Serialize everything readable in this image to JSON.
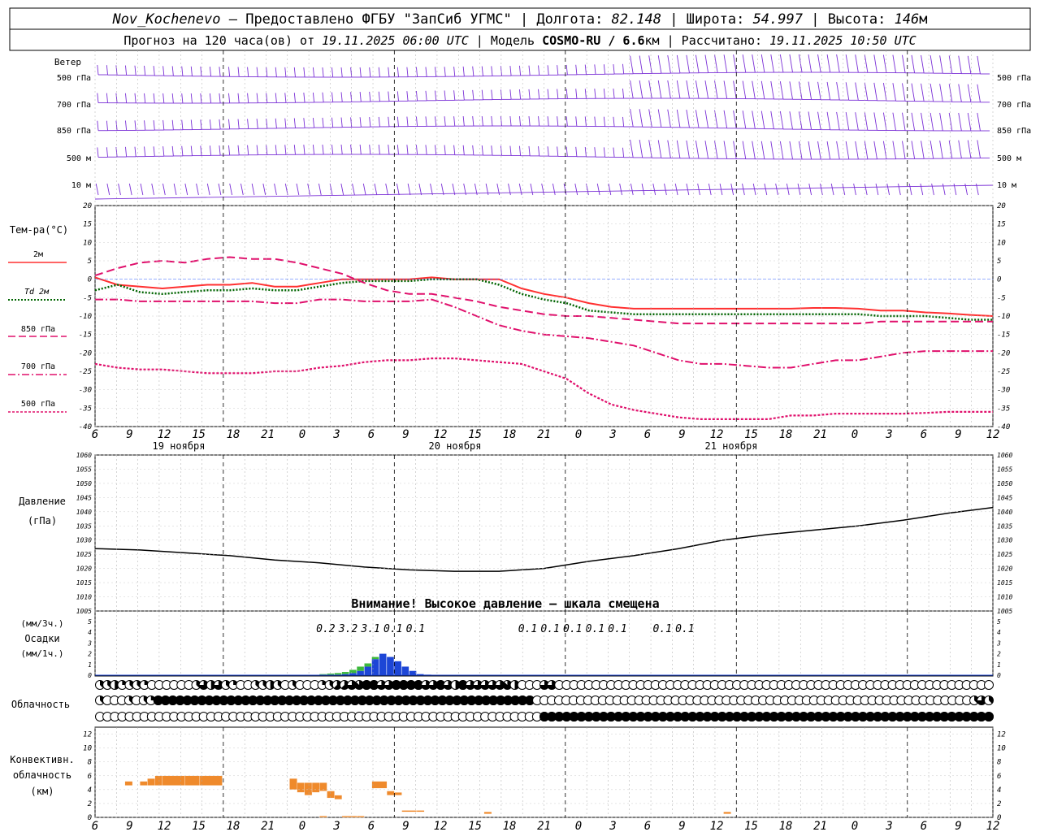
{
  "header": {
    "station": "Nov_Kochenevo",
    "provider": " – Предоставлено ФГБУ \"ЗапСиб УГМС\" | Долгота: ",
    "lon": "82.148",
    "lat_label": " | Широта: ",
    "lat": "54.997",
    "alt_label": " | Высота: ",
    "alt": "146",
    "alt_unit": "м",
    "line2_a": "Прогноз на 120 часа(ов) от ",
    "run_time": "19.11.2025 06:00 UTC",
    "line2_b": " | Модель ",
    "model": "COSMO-RU / 6.6",
    "model_unit": "км",
    "line2_c": " | Рассчитано: ",
    "calc_time": "19.11.2025 10:50 UTC"
  },
  "time_axis": {
    "hour_ticks": [
      "6",
      "9",
      "12",
      "15",
      "18",
      "21",
      "0",
      "3",
      "6",
      "9",
      "12",
      "15",
      "18",
      "21",
      "0",
      "3",
      "6",
      "9",
      "12",
      "15",
      "18",
      "21",
      "0",
      "3",
      "6",
      "9",
      "12"
    ],
    "day_labels": [
      "19 ноября",
      "20 ноября",
      "21 ноября"
    ]
  },
  "wind_panel": {
    "title": "Ветер",
    "levels": [
      "500 гПа",
      "700 гПа",
      "850 гПа",
      "500 м",
      "10  м"
    ]
  },
  "temp_panel": {
    "title": "Тем-ра(°C)",
    "legend": [
      {
        "label": "2м",
        "color": "#ff3030",
        "style": "solid"
      },
      {
        "label": "Td  2м",
        "color": "#006400",
        "style": "dotted"
      },
      {
        "label": "850 гПа",
        "color": "#e0106c",
        "style": "dashed"
      },
      {
        "label": "700 гПа",
        "color": "#e0106c",
        "style": "dashdot"
      },
      {
        "label": "500 гПа",
        "color": "#e0106c",
        "style": "dots"
      }
    ],
    "y_ticks": [
      "20",
      "15",
      "10",
      "5",
      "0",
      "-5",
      "-10",
      "-15",
      "-20",
      "-25",
      "-30",
      "-35",
      "-40"
    ]
  },
  "pressure_panel": {
    "title": "Давление",
    "unit": "(гПа)",
    "note": "Внимание! Высокое давление – шкала смещена",
    "y_ticks": [
      "1060",
      "1055",
      "1050",
      "1045",
      "1040",
      "1035",
      "1030",
      "1025",
      "1020",
      "1015",
      "1010",
      "1005"
    ]
  },
  "precip_panel": {
    "unit_top": "(мм/3ч.)",
    "title": "Осадки",
    "unit_bottom": "(мм/1ч.)",
    "y_ticks": [
      "5",
      "4",
      "3",
      "2",
      "1",
      "0"
    ],
    "totals": [
      "0.2",
      "3.2",
      "3.1",
      "0.1",
      "0.1",
      "0.1",
      "0.1",
      "0.1",
      "0.1",
      "0.1",
      "0.1",
      "0.1"
    ]
  },
  "cloud_panel": {
    "title": "Облачность"
  },
  "conv_panel": {
    "title_1": "Конвективн.",
    "title_2": "облачность",
    "unit": "(км)",
    "y_ticks": [
      "12",
      "10",
      "8",
      "6",
      "4",
      "2",
      "0"
    ]
  },
  "chart_data": [
    {
      "type": "line",
      "title": "Тем-ра(°C)",
      "x": [
        0,
        3,
        6,
        9,
        12,
        15,
        18,
        21,
        24,
        27,
        30,
        33,
        36,
        39,
        42,
        45,
        48,
        51,
        54,
        57,
        60,
        63,
        66,
        69,
        72,
        75,
        78,
        81,
        84,
        87,
        90,
        93,
        96,
        99,
        102,
        105,
        108,
        111,
        114,
        117,
        120
      ],
      "ylim": [
        -40,
        20
      ],
      "series": [
        {
          "name": "2м",
          "color": "#ff3030",
          "values": [
            0.5,
            -1.5,
            -2,
            -2.5,
            -2,
            -1.5,
            -1.5,
            -1,
            -2,
            -2,
            -1,
            0,
            0,
            0,
            0,
            0.5,
            0,
            0,
            0,
            -2.5,
            -4,
            -5,
            -6.5,
            -7.5,
            -8,
            -8,
            -8,
            -8,
            -8,
            -8,
            -8,
            -8,
            -7.8,
            -7.8,
            -8,
            -8.5,
            -8.5,
            -9,
            -9.3,
            -9.7,
            -10
          ]
        },
        {
          "name": "Td  2м",
          "color": "#006400",
          "values": [
            -3,
            -1.5,
            -3.5,
            -4,
            -3.5,
            -3,
            -3,
            -2.5,
            -3,
            -3,
            -2,
            -1,
            -0.5,
            -0.5,
            -0.5,
            0,
            0,
            0,
            -1.5,
            -4,
            -5.5,
            -6.5,
            -8.5,
            -9,
            -9.5,
            -9.5,
            -9.5,
            -9.5,
            -9.5,
            -9.5,
            -9.5,
            -9.5,
            -9.5,
            -9.5,
            -9.5,
            -10,
            -10,
            -10,
            -10.5,
            -11,
            -11
          ]
        },
        {
          "name": "850 гПа",
          "color": "#e0106c",
          "values": [
            1,
            3,
            4.5,
            5,
            4.5,
            5.5,
            6,
            5.5,
            5.5,
            4.5,
            3,
            1.5,
            -1,
            -3,
            -4,
            -4,
            -5,
            -6,
            -7.5,
            -8.5,
            -9.5,
            -10,
            -10,
            -10.5,
            -11,
            -11.5,
            -12,
            -12,
            -12,
            -12,
            -12,
            -12,
            -12,
            -12,
            -12,
            -11.5,
            -11.5,
            -11.5,
            -11.5,
            -11.5,
            -11.5
          ]
        },
        {
          "name": "700 гПа",
          "color": "#e0106c",
          "values": [
            -5.5,
            -5.5,
            -6,
            -6,
            -6,
            -6,
            -6,
            -6,
            -6.5,
            -6.5,
            -5.5,
            -5.5,
            -6,
            -6,
            -6,
            -5.5,
            -7.5,
            -10,
            -12.5,
            -14,
            -15,
            -15.5,
            -16,
            -17,
            -18,
            -20,
            -22,
            -23,
            -23,
            -23.5,
            -24,
            -24,
            -23,
            -22,
            -22,
            -21,
            -20,
            -19.5,
            -19.5,
            -19.5,
            -19.5
          ]
        },
        {
          "name": "500 гПа",
          "color": "#e0106c",
          "values": [
            -23,
            -24,
            -24.5,
            -24.5,
            -25,
            -25.5,
            -25.5,
            -25.5,
            -25,
            -25,
            -24,
            -23.5,
            -22.5,
            -22,
            -22,
            -21.5,
            -21.5,
            -22,
            -22.5,
            -23,
            -25,
            -27,
            -31,
            -34,
            -35.5,
            -36.5,
            -37.5,
            -38,
            -38,
            -38,
            -38,
            -37,
            -37,
            -36.5,
            -36.5,
            -36.5,
            -36.5,
            -36.3,
            -36,
            -36,
            -36
          ]
        }
      ]
    },
    {
      "type": "line",
      "title": "Давление",
      "x": [
        0,
        6,
        12,
        18,
        24,
        30,
        36,
        42,
        48,
        54,
        60,
        66,
        72,
        78,
        84,
        90,
        96,
        102,
        108,
        114,
        120
      ],
      "ylim": [
        1005,
        1060
      ],
      "series": [
        {
          "name": "Давление",
          "color": "#000000",
          "values": [
            1027,
            1026.5,
            1025.5,
            1024.5,
            1023,
            1022,
            1020.5,
            1019.5,
            1019,
            1019,
            1020,
            1022.5,
            1024.5,
            1027,
            1030,
            1032,
            1033.5,
            1035,
            1037,
            1039.5,
            1041.5
          ]
        }
      ]
    },
    {
      "type": "bar",
      "title": "Осадки",
      "x": [
        30,
        31,
        32,
        33,
        34,
        35,
        36,
        37,
        38,
        39,
        40,
        41,
        42,
        43,
        44
      ],
      "ylim": [
        0,
        5
      ],
      "series": [
        {
          "name": "liquid",
          "color": "#1d46d6",
          "values": [
            0.05,
            0.05,
            0.05,
            0.1,
            0.2,
            0.4,
            0.8,
            1.5,
            2.0,
            1.7,
            1.3,
            0.8,
            0.4,
            0.1,
            0.05
          ]
        },
        {
          "name": "mixed",
          "color": "#3cb83c",
          "values": [
            0.05,
            0.1,
            0.15,
            0.2,
            0.3,
            0.4,
            0.3,
            0.2,
            0,
            0,
            0,
            0,
            0,
            0,
            0
          ]
        }
      ],
      "totals_x": [
        33,
        36,
        39,
        42,
        45,
        60,
        63,
        66,
        69,
        72,
        78,
        81
      ]
    },
    {
      "type": "heatmap",
      "title": "Облачность",
      "rows": 3,
      "x_start": 0,
      "x_step": 1,
      "cover_in_eighths": [
        "3,3,4,2,3,3,2,0,0,0,0,0,0,3,6,4,6,3,2,0,0,3,3,4,3,0,3,0,0,0,2,3,5,5,6,7,8,8,6,6,8,8,8,8,6,6,8,6,4,8,6,6,6,6,6,7,4,0,0,0,6,6,0,0,0,0,0,0,0,0,0,0,0,0,0,0,0,0,0,0,0,0,0,0,0,0,0,0,0,0,0,0,0,0,0,0,0,0,0,0,0,0,0,0,0,0,0,0,0,0,0,0,0,0,0,0,0,0,0,0,0",
        "3,0,0,0,3,0,3,2,8,8,8,8,8,8,8,8,8,8,8,8,8,8,8,8,8,8,8,8,8,8,8,8,8,8,8,8,8,8,8,8,8,8,8,8,8,8,8,8,8,8,8,8,8,8,8,8,8,8,8,8,0,0,0,0,0,0,0,0,0,0,0,0,0,0,0,0,0,0,0,0,0,0,0,0,0,0,0,0,0,0,0,0,0,0,0,0,0,0,0,0,0,0,0,0,0,0,0,0,0,0,0,0,0,0,0,0,0,0,0,0,3,6,3",
        "0,0,0,0,0,0,0,0,0,0,0,0,0,0,0,0,0,0,0,0,0,0,0,0,0,0,0,0,0,0,0,0,0,0,0,0,0,0,0,0,0,0,0,0,0,0,0,0,0,0,0,0,0,0,0,0,0,0,0,0,8,8,8,8,8,8,8,8,8,8,8,8,8,8,8,8,8,8,8,8,8,8,8,8,8,8,8,8,8,8,8,8,8,8,8,8,8,8,8,8,8,8,8,8,8,8,8,8,8,8,8,8,8,8,8,8,8,8,8,8,8"
      ]
    },
    {
      "type": "bar",
      "title": "Конвективн. облачность",
      "ylim": [
        0,
        13
      ],
      "color": "#ef8a2c",
      "segments_hours_km": [
        [
          4,
          5,
          4.6,
          5.2
        ],
        [
          6,
          7,
          4.6,
          5.2
        ],
        [
          7,
          8,
          4.6,
          5.6
        ],
        [
          8,
          9,
          4.6,
          6
        ],
        [
          9,
          12,
          4.6,
          6
        ],
        [
          12,
          14,
          4.6,
          6
        ],
        [
          14,
          17,
          4.6,
          6
        ],
        [
          26,
          27,
          4,
          5.6
        ],
        [
          27,
          28,
          3.6,
          5
        ],
        [
          28,
          29,
          3.2,
          5
        ],
        [
          29,
          30,
          3.6,
          5
        ],
        [
          30,
          31,
          3.8,
          5
        ],
        [
          31,
          32,
          2.8,
          3.8
        ],
        [
          32,
          33,
          2.6,
          3.2
        ],
        [
          37,
          39,
          4.2,
          5.2
        ],
        [
          39,
          40,
          3.2,
          3.8
        ],
        [
          40,
          41,
          3.2,
          3.6
        ],
        [
          41,
          43,
          0.8,
          1
        ],
        [
          43,
          44,
          0.8,
          1
        ],
        [
          52,
          53,
          0.5,
          0.8
        ],
        [
          84,
          85,
          0.5,
          0.8
        ],
        [
          30,
          31,
          0,
          0.2
        ],
        [
          33,
          35,
          0,
          0.2
        ],
        [
          35,
          36,
          0,
          0.2
        ]
      ]
    }
  ]
}
